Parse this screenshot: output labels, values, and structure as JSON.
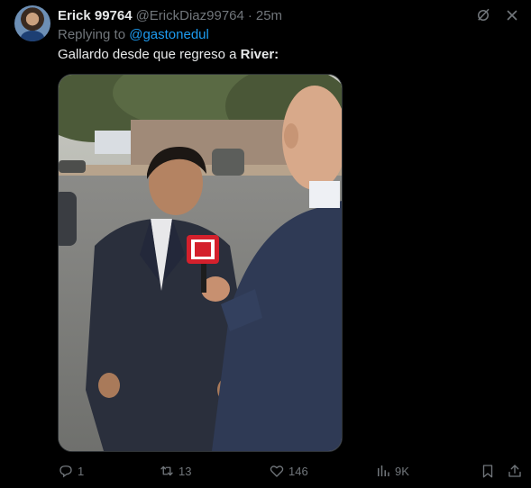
{
  "tweet": {
    "display_name": "Erick 99764",
    "handle": "@ErickDiaz99764",
    "separator": "·",
    "time": "25m",
    "replying_prefix": "Replying to ",
    "replying_to": "@gastonedul",
    "text_plain": "Gallardo desde que regreso a ",
    "text_bold": "River:"
  },
  "actions": {
    "replies": "1",
    "retweets": "13",
    "likes": "146",
    "views": "9K"
  },
  "icons": {
    "top": [
      "grok-icon",
      "more-icon"
    ],
    "actions": [
      "reply-icon",
      "retweet-icon",
      "like-icon",
      "views-icon",
      "bookmark-icon",
      "share-icon"
    ]
  },
  "colors": {
    "background": "#000000",
    "text": "#e7e9ea",
    "secondary": "#71767b",
    "link": "#1d9bf0",
    "mic_flag_red": "#d4202c"
  }
}
